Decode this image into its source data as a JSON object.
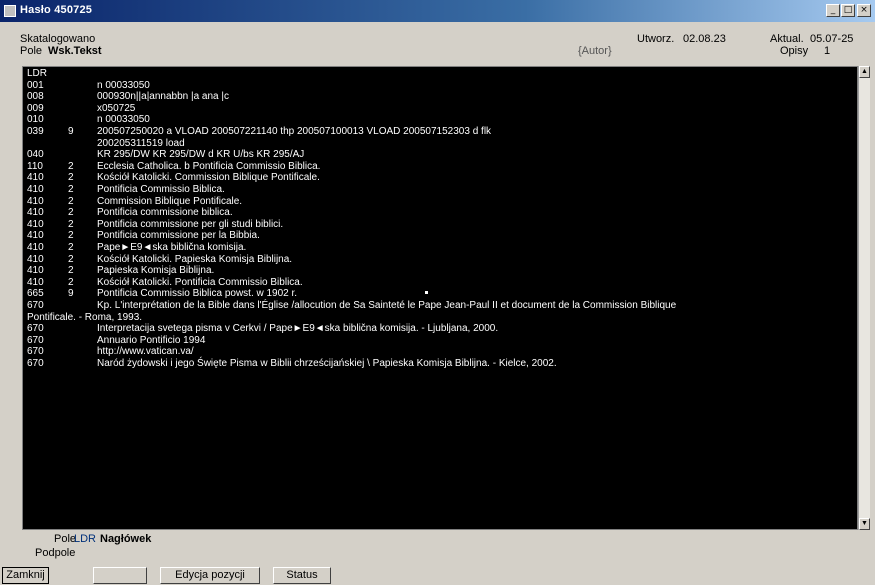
{
  "window": {
    "title": "Hasło 450725"
  },
  "header": {
    "status": "Skatalogowano",
    "pole_label": "Pole",
    "pole_value": "Wsk.Tekst",
    "utworz_label": "Utworz.",
    "utworz_value": "02.08.23",
    "aktual_label": "Aktual.",
    "aktual_value": "05.07-25",
    "autor": "{Autor}",
    "opisy_label": "Opisy",
    "opisy_value": "1"
  },
  "record": [
    {
      "tag": "LDR",
      "ind": "",
      "text": ""
    },
    {
      "tag": "001",
      "ind": "",
      "text": "n 00033050"
    },
    {
      "tag": "008",
      "ind": "",
      "text": "000930n||a|annabbn        |a ana   |c"
    },
    {
      "tag": "009",
      "ind": "",
      "text": "x050725"
    },
    {
      "tag": "010",
      "ind": "",
      "text": "n 00033050"
    },
    {
      "tag": "039",
      "ind": "9",
      "text": "200507250020     a VLOAD       200507221140       thp       200507100013       VLOAD          200507152303      d flk"
    },
    {
      "tag": "",
      "ind": "",
      "text": "200205311519      load"
    },
    {
      "tag": "040",
      "ind": "",
      "text": "KR 295/DW      KR 295/DW     d KR U/bs       KR 295/AJ"
    },
    {
      "tag": "110",
      "ind": "2",
      "text": "Ecclesia Catholica.    b Pontificia Commissio Biblica."
    },
    {
      "tag": "410",
      "ind": "2",
      "text": "Kościół Katolicki.       Commission Biblique Pontificale."
    },
    {
      "tag": "410",
      "ind": "2",
      "text": "Pontificia Commissio Biblica."
    },
    {
      "tag": "410",
      "ind": "2",
      "text": "Commission Biblique Pontificale."
    },
    {
      "tag": "410",
      "ind": "2",
      "text": "Pontificia commissione biblica."
    },
    {
      "tag": "410",
      "ind": "2",
      "text": "Pontificia commissione per gli studi biblici."
    },
    {
      "tag": "410",
      "ind": "2",
      "text": "Pontificia commissione per la Bibbia."
    },
    {
      "tag": "410",
      "ind": "2",
      "text": "Pape►E9◄ska biblična komisija."
    },
    {
      "tag": "410",
      "ind": "2",
      "text": "Kościół Katolicki.       Papieska Komisja Biblijna."
    },
    {
      "tag": "410",
      "ind": "2",
      "text": "Papieska Komisja Biblijna."
    },
    {
      "tag": "410",
      "ind": "2",
      "text": "Kościół Katolicki.       Pontificia Commissio Biblica."
    },
    {
      "tag": "665",
      "ind": "9",
      "text": "Pontificia Commissio Biblica powst. w 1902 r."
    },
    {
      "tag": "670",
      "ind": "",
      "text": "Kp. L'interprétation de la Bible dans l'Église /allocution de Sa Sainteté le Pape Jean-Paul II et document de la Commission Biblique"
    },
    {
      "tag": "",
      "ind": "",
      "text": "Pontificale. - Roma, 1993."
    },
    {
      "tag": "670",
      "ind": "",
      "text": "Interpretacija svetega pisma v Cerkvi / Pape►E9◄ska biblična komisija. - Ljubljana, 2000."
    },
    {
      "tag": "670",
      "ind": "",
      "text": "Annuario Pontificio 1994"
    },
    {
      "tag": "670",
      "ind": "",
      "text": "http://www.vatican.va/"
    },
    {
      "tag": "670",
      "ind": "",
      "text": "Naród żydowski i jego Święte Pisma w Biblii chrześcijańskiej \\ Papieska Komisja Biblijna. - Kielce, 2002."
    }
  ],
  "footer": {
    "pole_label": "Pole",
    "pole_value": "LDR",
    "pole_desc": "Nagłówek",
    "podpole_label": "Podpole"
  },
  "buttons": {
    "zamknij": "Zamknij",
    "edycja": "Edycja pozycji",
    "status": "Status"
  }
}
